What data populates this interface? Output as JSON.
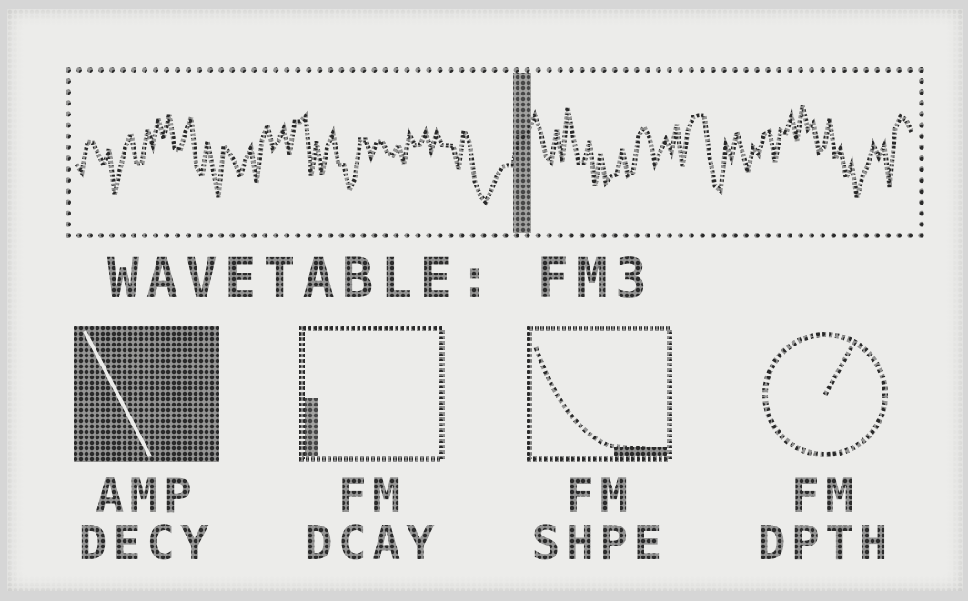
{
  "wavetable": {
    "label_prefix": "WAVETABLE:",
    "name": "FM3"
  },
  "params": [
    {
      "line1": "AMP",
      "line2": "DECY",
      "icon": "decay-ramp-icon"
    },
    {
      "line1": "FM",
      "line2": "DCAY",
      "icon": "decay-level-icon"
    },
    {
      "line1": "FM",
      "line2": "SHPE",
      "icon": "shape-curve-icon"
    },
    {
      "line1": "FM",
      "line2": "DPTH",
      "icon": "depth-knob-icon"
    }
  ],
  "colors": {
    "lcd_background": "#ececea",
    "pixel_dark": "#2a2a2a"
  }
}
